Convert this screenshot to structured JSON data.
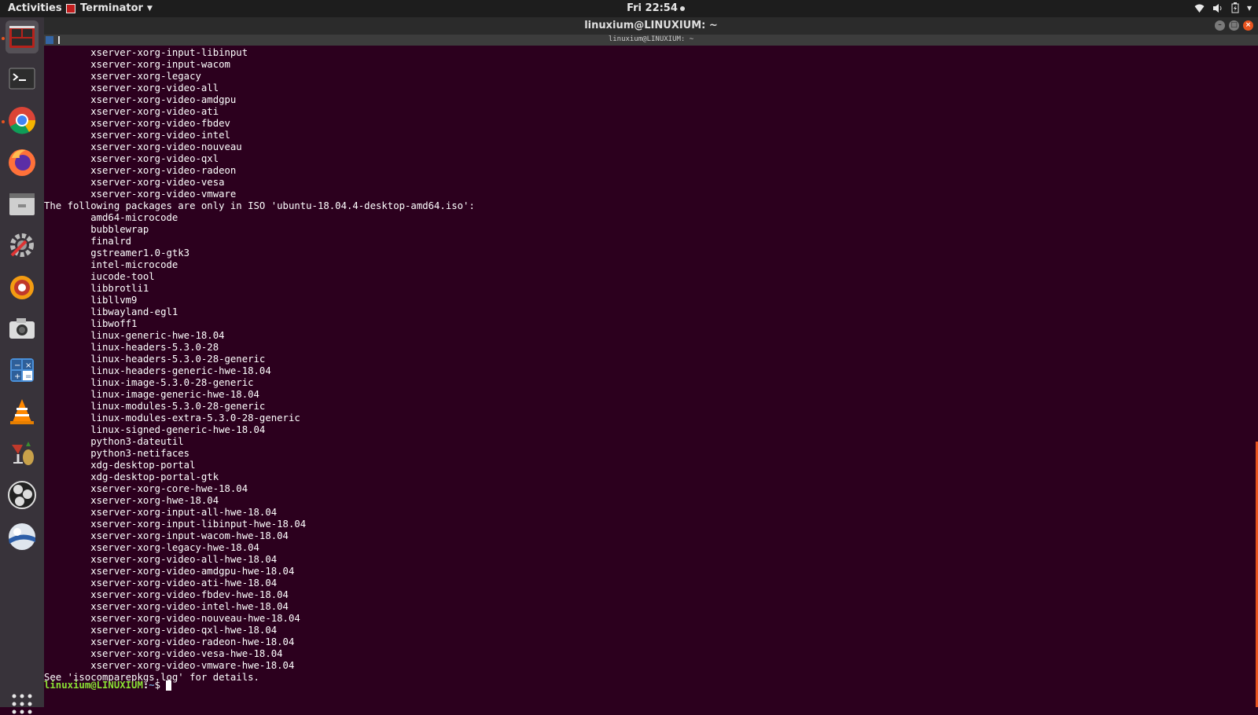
{
  "top_bar": {
    "activities": "Activities",
    "app_menu": "Terminator",
    "clock": "Fri 22:54"
  },
  "dock": {
    "items": [
      {
        "name": "terminator",
        "icon": "terminator-icon"
      },
      {
        "name": "terminal",
        "icon": "terminal-icon"
      },
      {
        "name": "chrome",
        "icon": "chrome-icon"
      },
      {
        "name": "firefox",
        "icon": "firefox-icon"
      },
      {
        "name": "files",
        "icon": "files-icon"
      },
      {
        "name": "settings",
        "icon": "settings-icon"
      },
      {
        "name": "xsane",
        "icon": "xsane-icon"
      },
      {
        "name": "screenshot",
        "icon": "camera-icon"
      },
      {
        "name": "calculator",
        "icon": "calculator-icon"
      },
      {
        "name": "vlc",
        "icon": "vlc-icon"
      },
      {
        "name": "winetricks",
        "icon": "winetricks-icon"
      },
      {
        "name": "obs",
        "icon": "obs-icon"
      },
      {
        "name": "openshot",
        "icon": "openshot-icon"
      }
    ],
    "show_apps": "show-apps-icon"
  },
  "window": {
    "title": "linuxium@LINUXIUM: ~",
    "tab_title": "linuxium@LINUXIUM: ~"
  },
  "terminal": {
    "lines": [
      "        xserver-xorg-input-libinput",
      "        xserver-xorg-input-wacom",
      "        xserver-xorg-legacy",
      "        xserver-xorg-video-all",
      "        xserver-xorg-video-amdgpu",
      "        xserver-xorg-video-ati",
      "        xserver-xorg-video-fbdev",
      "        xserver-xorg-video-intel",
      "        xserver-xorg-video-nouveau",
      "        xserver-xorg-video-qxl",
      "        xserver-xorg-video-radeon",
      "        xserver-xorg-video-vesa",
      "        xserver-xorg-video-vmware",
      "The following packages are only in ISO 'ubuntu-18.04.4-desktop-amd64.iso':",
      "        amd64-microcode",
      "        bubblewrap",
      "        finalrd",
      "        gstreamer1.0-gtk3",
      "        intel-microcode",
      "        iucode-tool",
      "        libbrotli1",
      "        libllvm9",
      "        libwayland-egl1",
      "        libwoff1",
      "        linux-generic-hwe-18.04",
      "        linux-headers-5.3.0-28",
      "        linux-headers-5.3.0-28-generic",
      "        linux-headers-generic-hwe-18.04",
      "        linux-image-5.3.0-28-generic",
      "        linux-image-generic-hwe-18.04",
      "        linux-modules-5.3.0-28-generic",
      "        linux-modules-extra-5.3.0-28-generic",
      "        linux-signed-generic-hwe-18.04",
      "        python3-dateutil",
      "        python3-netifaces",
      "        xdg-desktop-portal",
      "        xdg-desktop-portal-gtk",
      "        xserver-xorg-core-hwe-18.04",
      "        xserver-xorg-hwe-18.04",
      "        xserver-xorg-input-all-hwe-18.04",
      "        xserver-xorg-input-libinput-hwe-18.04",
      "        xserver-xorg-input-wacom-hwe-18.04",
      "        xserver-xorg-legacy-hwe-18.04",
      "        xserver-xorg-video-all-hwe-18.04",
      "        xserver-xorg-video-amdgpu-hwe-18.04",
      "        xserver-xorg-video-ati-hwe-18.04",
      "        xserver-xorg-video-fbdev-hwe-18.04",
      "        xserver-xorg-video-intel-hwe-18.04",
      "        xserver-xorg-video-nouveau-hwe-18.04",
      "        xserver-xorg-video-qxl-hwe-18.04",
      "        xserver-xorg-video-radeon-hwe-18.04",
      "        xserver-xorg-video-vesa-hwe-18.04",
      "        xserver-xorg-video-vmware-hwe-18.04",
      "See 'isocomparepkgs.log' for details."
    ],
    "prompt": {
      "user_host": "linuxium@LINUXIUM",
      "sep": ":",
      "path": "~",
      "symbol": "$ "
    }
  },
  "colors": {
    "terminal_bg": "#2c001e",
    "prompt_green": "#8ae234",
    "accent": "#e95420"
  }
}
